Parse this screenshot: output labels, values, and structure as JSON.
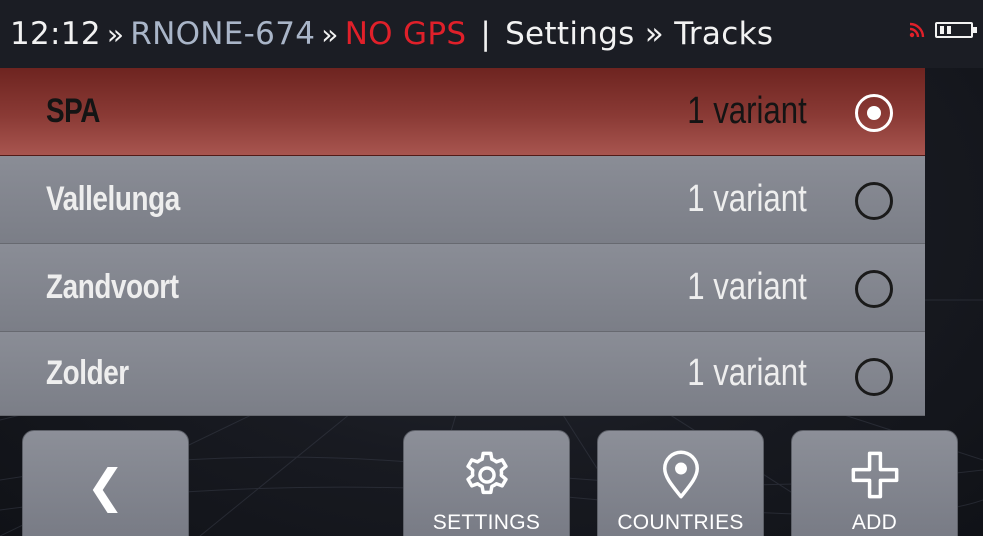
{
  "status_bar": {
    "time": "12:12",
    "separator": "»",
    "device": "RNONE-674",
    "gps_status": "NO GPS",
    "pipe": "|",
    "breadcrumb": "Settings » Tracks",
    "icons": [
      "rss-signal-icon",
      "battery-icon"
    ],
    "colors": {
      "gps_error": "#e0202a",
      "device": "#a9b5c8",
      "signal": "#e0202a"
    }
  },
  "tracks": [
    {
      "name": "SPA",
      "variants": "1 variant",
      "selected": true
    },
    {
      "name": "Vallelunga",
      "variants": "1 variant",
      "selected": false
    },
    {
      "name": "Zandvoort",
      "variants": "1 variant",
      "selected": false
    },
    {
      "name": "Zolder",
      "variants": "1 variant",
      "selected": false
    }
  ],
  "bottom_bar": {
    "back": {
      "label": "❮",
      "icon": "back-chevron-icon"
    },
    "settings": {
      "label": "SETTINGS",
      "icon": "gear-icon"
    },
    "countries": {
      "label": "COUNTRIES",
      "icon": "location-pin-icon"
    },
    "add": {
      "label": "ADD",
      "icon": "plus-icon"
    }
  },
  "colors": {
    "selected_row": "#8a3a35",
    "row": "#7f828b",
    "button": "#808390",
    "background": "#181a21"
  }
}
